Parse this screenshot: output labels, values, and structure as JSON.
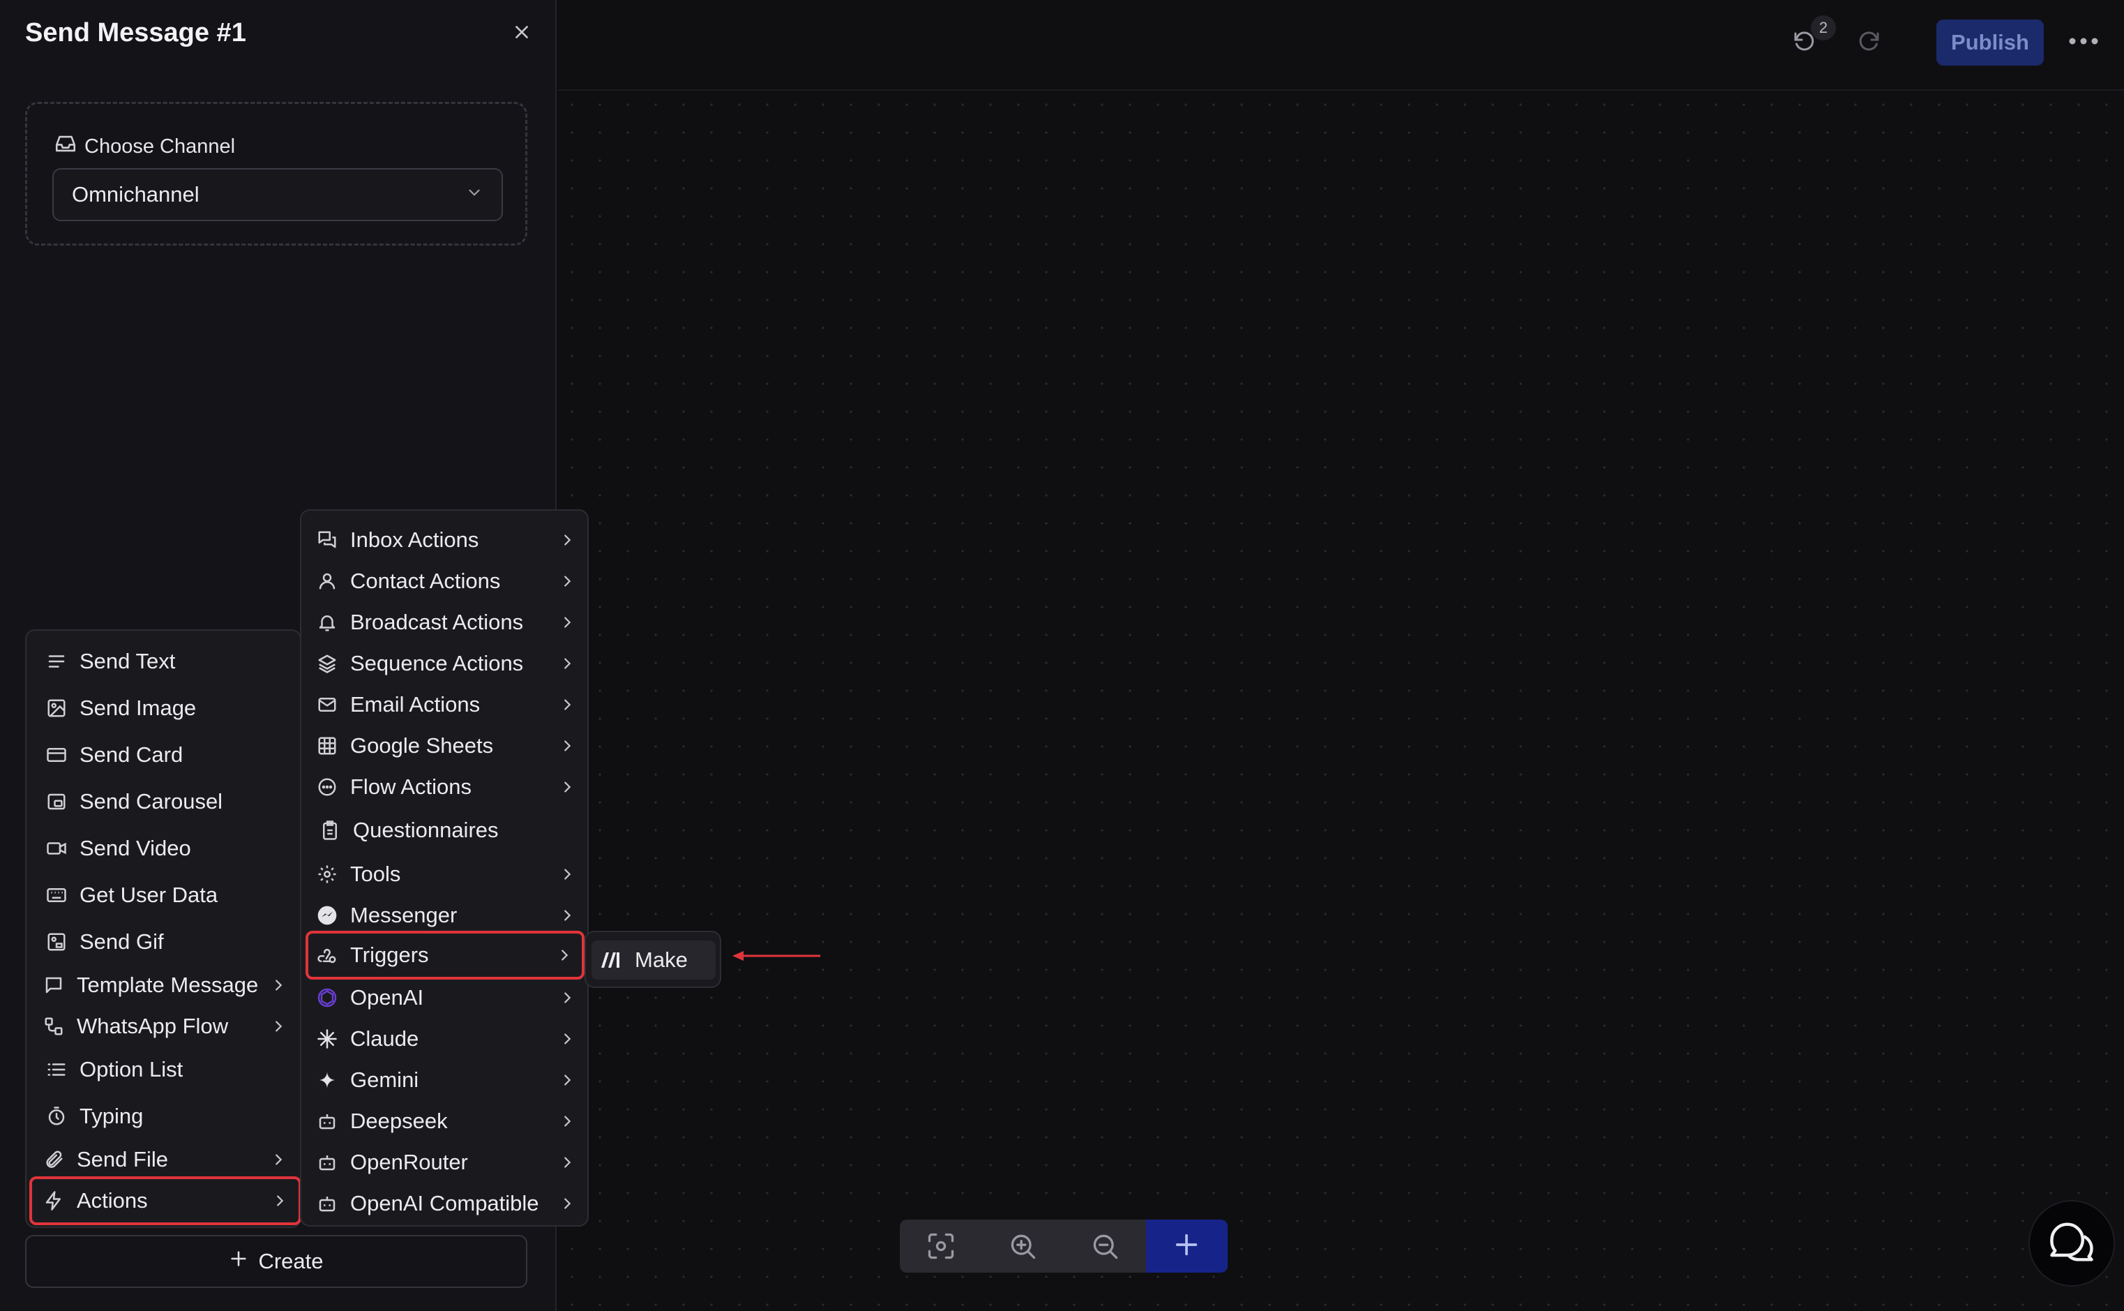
{
  "panel": {
    "title": "Send Message #1",
    "channel_label": "Choose Channel",
    "channel_value": "Omnichannel",
    "create_label": "Create"
  },
  "topbar": {
    "undo_badge": "2",
    "publish_label": "Publish"
  },
  "menu_left": {
    "items": [
      {
        "label": "Send Text",
        "icon": "text-lines-icon"
      },
      {
        "label": "Send Image",
        "icon": "image-icon"
      },
      {
        "label": "Send Card",
        "icon": "card-icon"
      },
      {
        "label": "Send Carousel",
        "icon": "carousel-icon"
      },
      {
        "label": "Send Video",
        "icon": "video-icon"
      },
      {
        "label": "Get User Data",
        "icon": "keyboard-icon"
      },
      {
        "label": "Send Gif",
        "icon": "gif-icon"
      },
      {
        "label": "Template Message",
        "icon": "message-square-icon"
      },
      {
        "label": "WhatsApp Flow",
        "icon": "flow-icon"
      },
      {
        "label": "Option List",
        "icon": "list-icon"
      },
      {
        "label": "Typing",
        "icon": "timer-icon"
      },
      {
        "label": "Send File",
        "icon": "paperclip-icon"
      },
      {
        "label": "Actions",
        "icon": "lightning-icon"
      }
    ]
  },
  "menu_mid": {
    "items": [
      {
        "label": "Inbox Actions",
        "icon": "inbox-icon"
      },
      {
        "label": "Contact Actions",
        "icon": "user-icon"
      },
      {
        "label": "Broadcast Actions",
        "icon": "bell-icon"
      },
      {
        "label": "Sequence Actions",
        "icon": "layers-icon"
      },
      {
        "label": "Email Actions",
        "icon": "mail-icon"
      },
      {
        "label": "Google Sheets",
        "icon": "table-icon"
      },
      {
        "label": "Flow Actions",
        "icon": "dots-circle-icon"
      },
      {
        "label": "Questionnaires",
        "icon": "clipboard-icon"
      },
      {
        "label": "Tools",
        "icon": "gear-icon"
      },
      {
        "label": "Messenger",
        "icon": "messenger-icon"
      },
      {
        "label": "Triggers",
        "icon": "webhook-icon"
      },
      {
        "label": "OpenAI",
        "icon": "openai-icon"
      },
      {
        "label": "Claude",
        "icon": "claude-icon"
      },
      {
        "label": "Gemini",
        "icon": "gemini-icon"
      },
      {
        "label": "Deepseek",
        "icon": "bot-icon"
      },
      {
        "label": "OpenRouter",
        "icon": "bot-icon"
      },
      {
        "label": "OpenAI Compatible",
        "icon": "bot-icon"
      }
    ]
  },
  "menu_make": {
    "label": "Make",
    "icon": "make-logo-icon"
  },
  "colors": {
    "highlight": "#e0343b",
    "publish_bg": "#1b2a6b",
    "add_bg": "#16248a"
  }
}
